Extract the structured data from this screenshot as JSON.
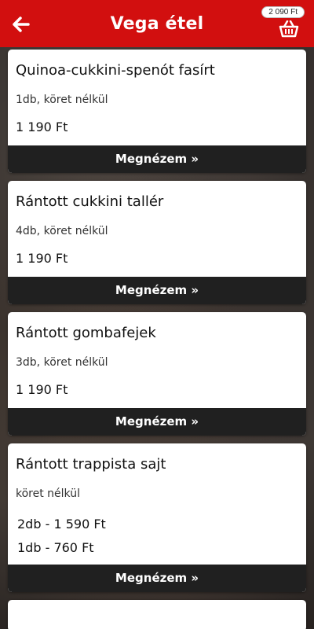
{
  "header": {
    "title": "Vega étel",
    "back_icon": "arrow-left-icon",
    "cart_total": "2 090 Ft",
    "cart_icon": "basket-icon",
    "accent": "#d20f0f"
  },
  "items": [
    {
      "name": "Quinoa-cukkini-spenót fasírt",
      "desc": "1db, köret nélkül",
      "price": "1 190 Ft",
      "button": "Megnézem »"
    },
    {
      "name": "Rántott cukkini tallér",
      "desc": "4db, köret nélkül",
      "price": "1 190 Ft",
      "button": "Megnézem »"
    },
    {
      "name": "Rántott gombafejek",
      "desc": "3db, köret nélkül",
      "price": "1 190 Ft",
      "button": "Megnézem »"
    },
    {
      "name": "Rántott trappista sajt",
      "desc": "köret nélkül",
      "prices": [
        "2db - 1 590 Ft",
        "1db - 760 Ft"
      ],
      "button": "Megnézem »"
    }
  ],
  "colors": {
    "button_bg": "#202020",
    "card_bg": "#ffffff"
  }
}
